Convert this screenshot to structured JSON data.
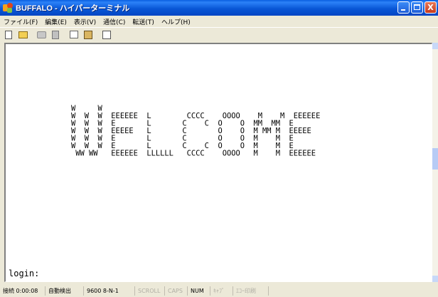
{
  "window": {
    "title": "BUFFALO - ハイパーターミナル",
    "min_label": "",
    "max_label": "",
    "close_label": "X"
  },
  "menu": {
    "items": [
      "ファイル(F)",
      "編集(E)",
      "表示(V)",
      "通信(C)",
      "転送(T)",
      "ヘルプ(H)"
    ]
  },
  "toolbar": {
    "icons": [
      "new-file-icon",
      "open-folder-icon",
      "connect-icon",
      "disconnect-icon",
      "send-icon",
      "receive-icon",
      "properties-icon"
    ]
  },
  "terminal": {
    "banner": "W     W\nW  W  W  EEEEEE  L        CCCC    OOOO    M    M  EEEEEE\nW  W  W  E       L       C    C  O    O  MM  MM  E\nW  W  W  EEEEE   L       C       O    O  M MM M  EEEEE\nW  W  W  E       L       C       O    O  M    M  E\nW  W  W  E       L       C    C  O    O  M    M  E\n WW WW   EEEEEE  LLLLLL   CCCC    OOOO   M    M  EEEEEE",
    "prompt": "login:"
  },
  "status": {
    "connected": "接続 0:00:08",
    "detect": "自動検出",
    "params": "9600 8-N-1",
    "scroll": "SCROLL",
    "caps": "CAPS",
    "num": "NUM",
    "capture": "ｷｬﾌﾟ",
    "echo": "ｴｺｰ印刷"
  },
  "colors": {
    "titlebar": "#0957d6",
    "window_bg": "#ece9d8",
    "terminal_bg": "#ffffff",
    "terminal_fg": "#000000"
  }
}
